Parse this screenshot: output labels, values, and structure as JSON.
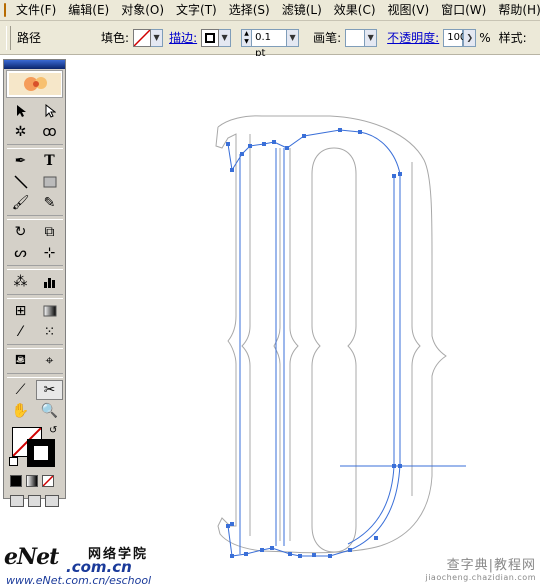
{
  "menubar": {
    "app_icon": "illustrator-app-icon",
    "items": [
      "文件(F)",
      "编辑(E)",
      "对象(O)",
      "文字(T)",
      "选择(S)",
      "滤镜(L)",
      "效果(C)",
      "视图(V)",
      "窗口(W)",
      "帮助(H)"
    ]
  },
  "controlbar": {
    "object_type": "路径",
    "fill_label": "填色:",
    "stroke_link": "描边:",
    "stroke_weight": "0.1 pt",
    "brush_label": "画笔:",
    "opacity_link": "不透明度:",
    "opacity_value": "100",
    "percent": "%",
    "style_label": "样式:"
  },
  "toolbox": {
    "tools": [
      "selection-tool-icon",
      "direct-selection-tool-icon",
      "magic-wand-tool-icon",
      "lasso-tool-icon",
      "pen-tool-icon",
      "type-tool-icon",
      "line-segment-tool-icon",
      "rectangle-tool-icon",
      "paintbrush-tool-icon",
      "pencil-tool-icon",
      "rotate-tool-icon",
      "scale-tool-icon",
      "warp-tool-icon",
      "free-transform-tool-icon",
      "symbol-sprayer-tool-icon",
      "column-graph-tool-icon",
      "mesh-tool-icon",
      "gradient-tool-icon",
      "eyedropper-tool-icon",
      "blend-tool-icon",
      "live-paint-bucket-tool-icon",
      "live-paint-selection-tool-icon",
      "slice-tool-icon",
      "scissors-tool-icon",
      "hand-tool-icon",
      "zoom-tool-icon"
    ],
    "active_tool": "scissors-tool-icon"
  },
  "watermark": {
    "left_brand": "eNet",
    "left_suffix": ".com.cn",
    "left_cn": "网络学院",
    "left_url": "www.eNet.com.cn/eschool",
    "right_cn": "查字典|教程网",
    "right_url": "jiaocheng.chazidian.com"
  },
  "colors": {
    "chrome": "#ece9d8",
    "selection_path": "#3a6fd8",
    "outline_path": "#a8a8a8"
  }
}
